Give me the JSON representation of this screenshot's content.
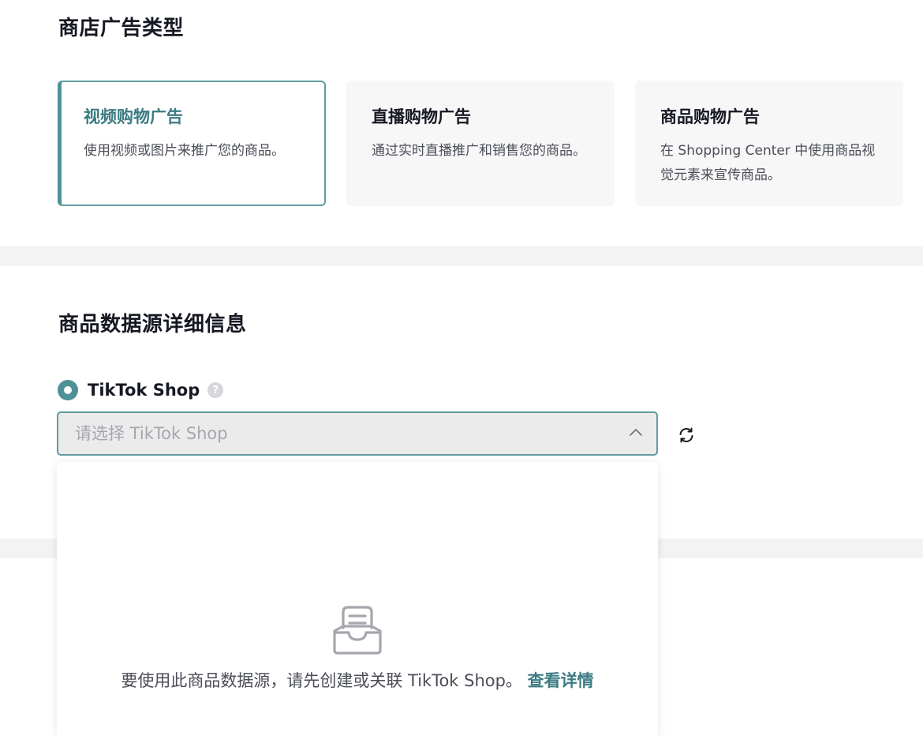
{
  "ad_type": {
    "title": "商店广告类型",
    "cards": [
      {
        "title": "视频购物广告",
        "desc": "使用视频或图片来推广您的商品。",
        "selected": true
      },
      {
        "title": "直播购物广告",
        "desc": "通过实时直播推广和销售您的商品。",
        "selected": false
      },
      {
        "title": "商品购物广告",
        "desc": "在 Shopping Center 中使用商品视觉元素来宣传商品。",
        "selected": false
      }
    ]
  },
  "data_source": {
    "title": "商品数据源详细信息",
    "radio_label": "TikTok Shop",
    "help_icon_glyph": "?",
    "select_placeholder": "请选择 TikTok Shop",
    "dropdown": {
      "empty_message": "要使用此商品数据源，请先创建或关联 TikTok Shop。",
      "link_text": "查看详情"
    }
  },
  "icons": {
    "help": "question-circle-icon",
    "chevron": "chevron-up-icon",
    "refresh": "refresh-icon",
    "empty": "inbox-icon"
  },
  "colors": {
    "accent": "#4f9198",
    "accent_text": "#3b7c82",
    "border_focus": "#5f9ca0",
    "band": "#f3f3f4",
    "card_bg": "#f7f7f8"
  }
}
